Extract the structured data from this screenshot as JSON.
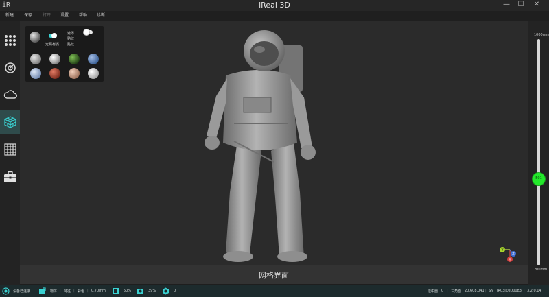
{
  "window": {
    "logo_text": "iR",
    "title": "iReal 3D",
    "minimize_glyph": "—",
    "maximize_glyph": "☐",
    "close_glyph": "✕"
  },
  "menu": {
    "items": [
      {
        "label": "新建",
        "enabled": true
      },
      {
        "label": "保存",
        "enabled": true
      },
      {
        "label": "打开",
        "enabled": false
      },
      {
        "label": "设置",
        "enabled": true
      },
      {
        "label": "帮助",
        "enabled": true
      },
      {
        "label": "诊断",
        "enabled": true
      }
    ]
  },
  "toolbar": {
    "tools": [
      {
        "name": "grid-dots-icon",
        "active": false
      },
      {
        "name": "scan-icon",
        "active": false
      },
      {
        "name": "cloud-icon",
        "active": false
      },
      {
        "name": "mesh-cube-icon",
        "active": true
      },
      {
        "name": "tile-grid-icon",
        "active": false
      },
      {
        "name": "toolbox-icon",
        "active": false
      }
    ]
  },
  "material_panel": {
    "smooth_shading_label": "光照材质",
    "smooth_shading_on": true,
    "options_labels": [
      "遮罩",
      "贴纹",
      "贴纹"
    ],
    "texture_toggle_on": false,
    "swatches": [
      {
        "name": "silver",
        "color": "#a9a9a9"
      },
      {
        "name": "chrome",
        "color": "#cfcfcf"
      },
      {
        "name": "green-glass",
        "color": "#2e5a21"
      },
      {
        "name": "blue-metal",
        "color": "#5b7fae"
      },
      {
        "name": "light-blue",
        "color": "#8ea2c2"
      },
      {
        "name": "red-clay",
        "color": "#a8412f"
      },
      {
        "name": "skin",
        "color": "#c79b84"
      },
      {
        "name": "pearl",
        "color": "#d8d8d8"
      }
    ]
  },
  "viewport": {
    "mode_label": "网格界面",
    "axis_labels": {
      "x": "X",
      "y": "Y",
      "z": "Z"
    }
  },
  "point_distance_slider": {
    "max_label": "1000mm",
    "min_label": "200mm",
    "value_label": "501",
    "value_fraction": 0.6
  },
  "status": {
    "device_label": "设备已连接",
    "mode_label": "物体",
    "feature_label": "特征",
    "color_label": "彩色",
    "resolution": "0.70mm",
    "cpu_percent": "50%",
    "memory_percent": "39%",
    "points_count": "0",
    "selected_label": "选中面",
    "selected_value": "0",
    "triangle_label": "三角面",
    "triangle_value": "20,608,041",
    "sn_label": "SN",
    "sn_value": "IR03IZ0D0083",
    "version": "3.2.0.14"
  },
  "colors": {
    "accent": "#3ad2d2",
    "slider_knob": "#23e82b",
    "active_tool_bg": "#2f4b4b",
    "statusbar_bg": "#1d2b2d"
  }
}
